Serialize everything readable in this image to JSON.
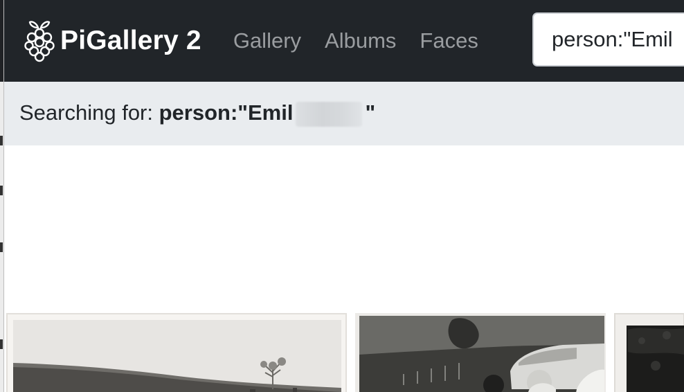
{
  "app": {
    "title": "PiGallery 2"
  },
  "nav": {
    "items": [
      {
        "label": "Gallery"
      },
      {
        "label": "Albums"
      },
      {
        "label": "Faces"
      }
    ]
  },
  "search": {
    "value": "person:\"Emil"
  },
  "status": {
    "prefix": "Searching for: ",
    "query_start": "person:\"Emil",
    "query_end": "\""
  },
  "colors": {
    "navbar": "#212529",
    "status_bar": "#e9ecef",
    "nav_link": "#9a9da0"
  },
  "icons": {
    "brand": "raspberry-pi-icon"
  }
}
